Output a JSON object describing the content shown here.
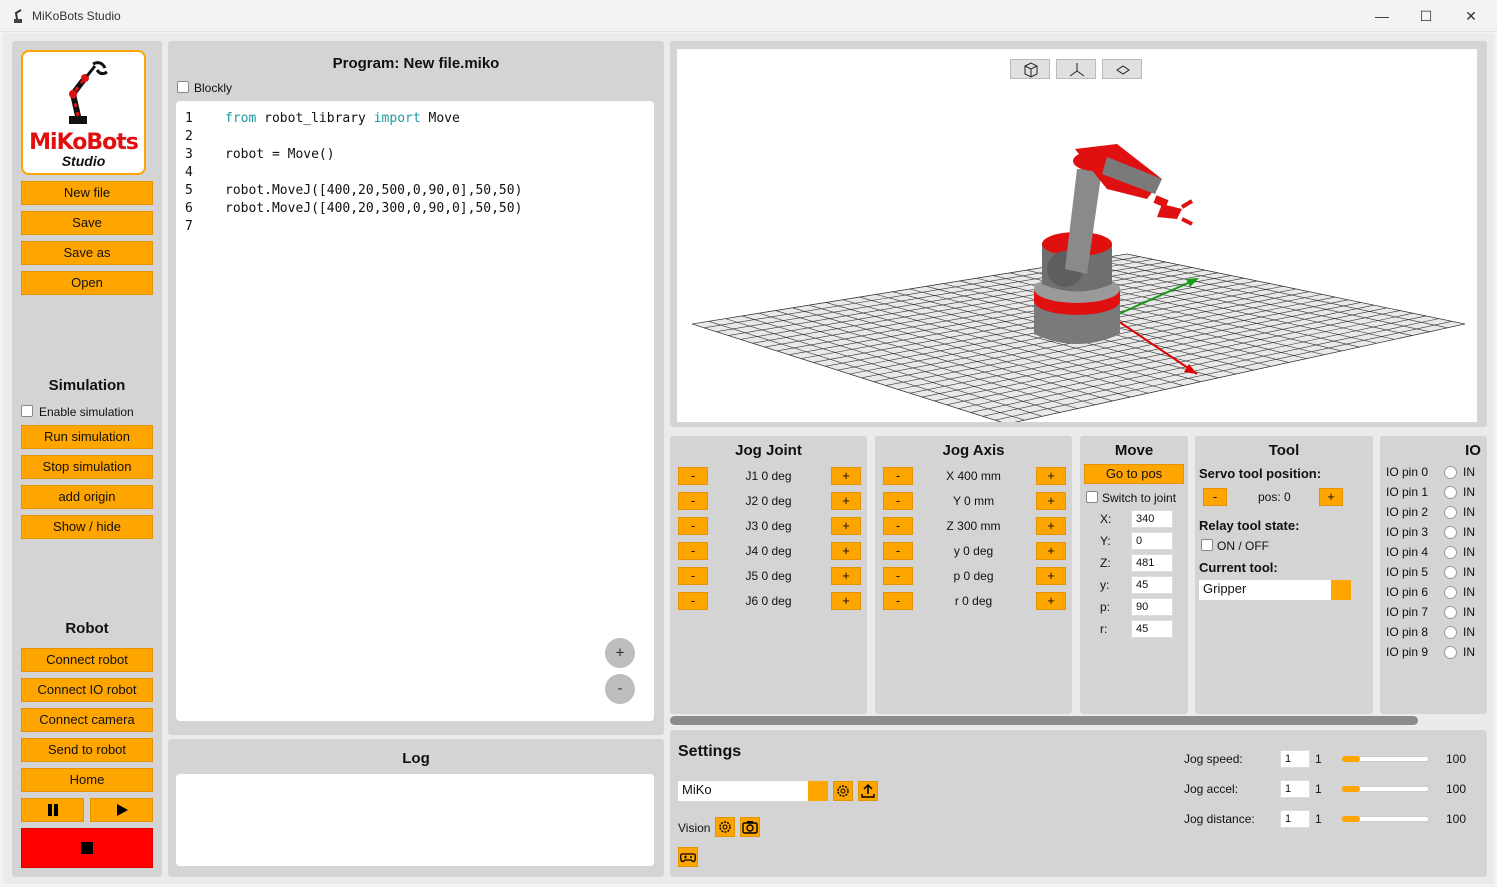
{
  "window": {
    "title": "MiKoBots Studio",
    "minimize": "—",
    "maximize": "☐",
    "close": "✕"
  },
  "logo": {
    "line1": "MiKoBots",
    "line2": "Studio"
  },
  "file_buttons": {
    "new": "New file",
    "save": "Save",
    "save_as": "Save as",
    "open": "Open"
  },
  "simulation": {
    "title": "Simulation",
    "enable_label": "Enable simulation",
    "run": "Run simulation",
    "stop": "Stop simulation",
    "add_origin": "add origin",
    "show_hide": "Show / hide"
  },
  "robot": {
    "title": "Robot",
    "connect_robot": "Connect robot",
    "connect_io": "Connect IO robot",
    "connect_camera": "Connect camera",
    "send": "Send to robot",
    "home": "Home",
    "pause_icon": "pause-icon",
    "play_icon": "play-icon",
    "stop_icon": "stop-icon"
  },
  "program": {
    "title": "Program: New file.miko",
    "blockly_label": "Blockly",
    "zoom_in": "+",
    "zoom_out": "-",
    "lines": [
      {
        "n": "1",
        "parts": [
          [
            "kw",
            "from"
          ],
          [
            "t",
            " robot_library "
          ],
          [
            "kw",
            "import"
          ],
          [
            "t",
            " Move"
          ]
        ]
      },
      {
        "n": "2",
        "parts": []
      },
      {
        "n": "3",
        "parts": [
          [
            "t",
            "robot = Move()"
          ]
        ]
      },
      {
        "n": "4",
        "parts": []
      },
      {
        "n": "5",
        "parts": [
          [
            "t",
            "robot.MoveJ([400,20,500,0,90,0],50,50)"
          ]
        ]
      },
      {
        "n": "6",
        "parts": [
          [
            "t",
            "robot.MoveJ([400,20,300,0,90,0],50,50)"
          ]
        ]
      },
      {
        "n": "7",
        "parts": []
      }
    ]
  },
  "log": {
    "title": "Log"
  },
  "viewer": {
    "view_buttons": [
      "cube-view-icon",
      "axes-view-icon",
      "top-view-icon"
    ]
  },
  "jog_joint": {
    "title": "Jog Joint",
    "minus": "-",
    "plus": "+",
    "rows": [
      "J1 0 deg",
      "J2 0 deg",
      "J3 0 deg",
      "J4 0 deg",
      "J5 0 deg",
      "J6 0 deg"
    ]
  },
  "jog_axis": {
    "title": "Jog Axis",
    "minus": "-",
    "plus": "+",
    "rows": [
      "X 400 mm",
      "Y 0 mm",
      "Z 300 mm",
      "y 0 deg",
      "p 0 deg",
      "r 0 deg"
    ]
  },
  "move": {
    "title": "Move",
    "go_to_pos": "Go to pos",
    "switch_label": "Switch to joint",
    "fields": [
      {
        "label": "X:",
        "value": "340"
      },
      {
        "label": "Y:",
        "value": "0"
      },
      {
        "label": "Z:",
        "value": "481"
      },
      {
        "label": "y:",
        "value": "45"
      },
      {
        "label": "p:",
        "value": "90"
      },
      {
        "label": "r:",
        "value": "45"
      }
    ]
  },
  "tool": {
    "title": "Tool",
    "servo_label": "Servo tool position:",
    "pos_label": "pos: 0",
    "minus": "-",
    "plus": "+",
    "relay_label": "Relay tool state:",
    "onoff_label": "ON / OFF",
    "current_label": "Current tool:",
    "current_value": "Gripper"
  },
  "io": {
    "title": "IO",
    "in_label": "IN",
    "pins": [
      "IO pin 0",
      "IO pin 1",
      "IO pin 2",
      "IO pin 3",
      "IO pin 4",
      "IO pin 5",
      "IO pin 6",
      "IO pin 7",
      "IO pin 8",
      "IO pin 9"
    ]
  },
  "settings": {
    "title": "Settings",
    "robot_value": "MiKo",
    "vision_label": "Vision",
    "sliders": [
      {
        "label": "Jog speed:",
        "input": "1",
        "min": "1",
        "max": "100",
        "value": 1
      },
      {
        "label": "Jog accel:",
        "input": "1",
        "min": "1",
        "max": "100",
        "value": 1
      },
      {
        "label": "Jog distance:",
        "input": "1",
        "min": "1",
        "max": "100",
        "value": 1
      }
    ]
  },
  "colors": {
    "accent": "#ffa500",
    "stop": "#ff0000",
    "panel": "#d4d4d4",
    "robot_red": "#e01010",
    "robot_gray": "#7a7a7a"
  }
}
